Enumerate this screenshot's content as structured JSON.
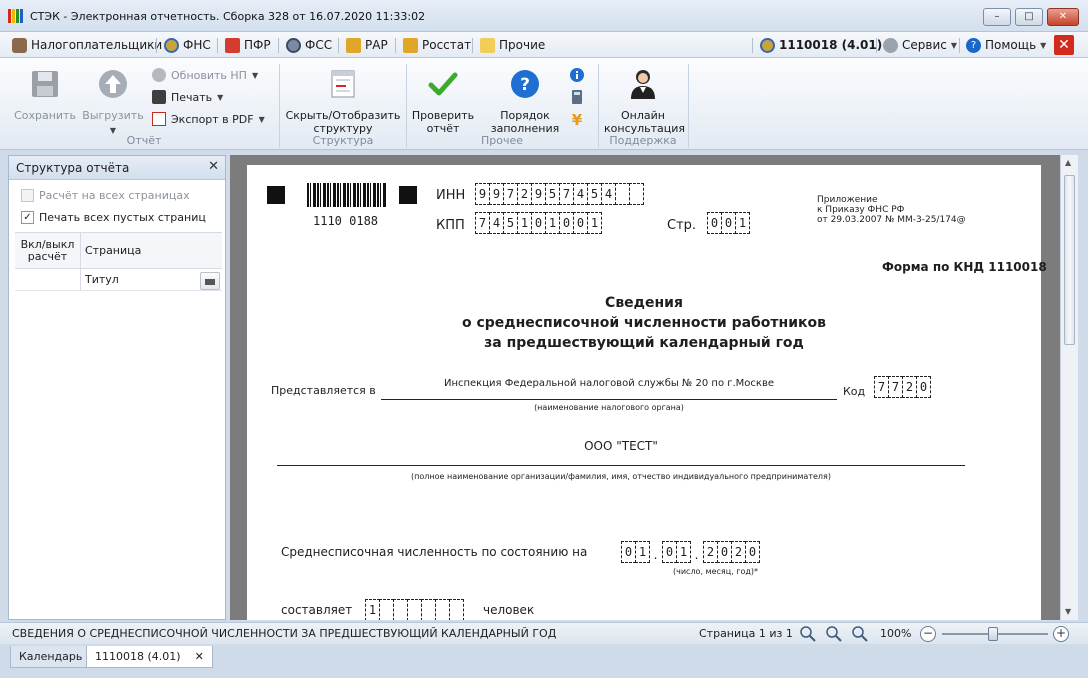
{
  "window": {
    "title": "СТЭК - Электронная отчетность. Сборка 328 от 16.07.2020 11:33:02",
    "controls": {
      "minimize": "–",
      "maximize": "□",
      "close": "✕"
    }
  },
  "menubar": {
    "items": [
      {
        "label": "Налогоплательщики",
        "icon": "users-icon"
      },
      {
        "label": "ФНС",
        "icon": "fns-emblem-icon"
      },
      {
        "label": "ПФР",
        "icon": "pfr-emblem-icon"
      },
      {
        "label": "ФСС",
        "icon": "fss-emblem-icon"
      },
      {
        "label": "РАР",
        "icon": "rar-emblem-icon"
      },
      {
        "label": "Росстат",
        "icon": "rosstat-emblem-icon"
      },
      {
        "label": "Прочие",
        "icon": "folder-icon"
      }
    ],
    "right": {
      "report_code": "1110018 (4.01)",
      "service": "Сервис",
      "help": "Помощь",
      "close": "✕"
    }
  },
  "ribbon": {
    "report_group": {
      "label": "Отчёт",
      "save": "Сохранить",
      "export": "Выгрузить",
      "update_np": "Обновить НП",
      "print": "Печать",
      "export_pdf": "Экспорт в PDF"
    },
    "structure_group": {
      "label": "Структура",
      "toggle_line1": "Скрыть/Отобразить",
      "toggle_line2": "структуру"
    },
    "other_group": {
      "label": "Прочее",
      "check_line1": "Проверить",
      "check_line2": "отчёт",
      "order_line1": "Порядок",
      "order_line2": "заполнения"
    },
    "support_group": {
      "label": "Поддержка",
      "online_line1": "Онлайн",
      "online_line2": "консультация"
    }
  },
  "left_panel": {
    "title": "Структура отчёта",
    "close": "✕",
    "option_calc_all": "Расчёт на всех страницах",
    "option_print_empty": "Печать всех пустых страниц",
    "check_mark": "✓",
    "columns": {
      "calc_line1": "Вкл/выкл",
      "calc_line2": "расчёт",
      "page": "Страница"
    },
    "rows": [
      {
        "page": "Титул"
      }
    ]
  },
  "document": {
    "barcode_number": "1110  0188",
    "inn_label": "ИНН",
    "inn_cells": [
      "9",
      "9",
      "7",
      "2",
      "9",
      "5",
      "7",
      "4",
      "5",
      "4",
      "",
      ""
    ],
    "kpp_label": "КПП",
    "kpp_cells": [
      "7",
      "4",
      "5",
      "1",
      "0",
      "1",
      "0",
      "0",
      "1"
    ],
    "page_label": "Стр.",
    "page_cells": [
      "0",
      "0",
      "1"
    ],
    "appendix_line1": "Приложение",
    "appendix_line2": "к Приказу ФНС РФ",
    "appendix_line3": "от 29.03.2007 № ММ-3-25/174@",
    "form_code": "Форма по КНД 1110018",
    "title_line1": "Сведения",
    "title_line2": "о среднесписочной численности работников",
    "title_line3": "за предшествующий календарный год",
    "presented_label": "Представляется в",
    "tax_authority": "Инспекция Федеральной налоговой службы № 20 по г.Москве",
    "tax_authority_caption": "(наименование налогового органа)",
    "code_label": "Код",
    "code_cells": [
      "7",
      "7",
      "2",
      "0"
    ],
    "org_name": "ООО \"ТЕСТ\"",
    "org_caption": "(полное наименование организации/фамилия, имя, отчество индивидуального предпринимателя)",
    "headcount_label": "Среднесписочная численность по состоянию на",
    "date_day": [
      "0",
      "1"
    ],
    "date_month": [
      "0",
      "1"
    ],
    "date_year": [
      "2",
      "0",
      "2",
      "0"
    ],
    "date_caption": "(число, месяц, год)*",
    "amount_label": "составляет",
    "amount_cells": [
      "1",
      "",
      "",
      "",
      "",
      "",
      ""
    ],
    "amount_unit": "человек"
  },
  "statusbar": {
    "doc_name": "СВЕДЕНИЯ О СРЕДНЕСПИСОЧНОЙ ЧИСЛЕННОСТИ ЗА ПРЕДШЕСТВУЮЩИЙ КАЛЕНДАРНЫЙ ГОД",
    "page_info": "Страница 1 из 1",
    "zoom": "100%",
    "zoom_minus": "−",
    "zoom_plus": "+"
  },
  "tabs": [
    {
      "label": "Календарь"
    },
    {
      "label": "1110018 (4.01)",
      "close": "✕"
    }
  ]
}
